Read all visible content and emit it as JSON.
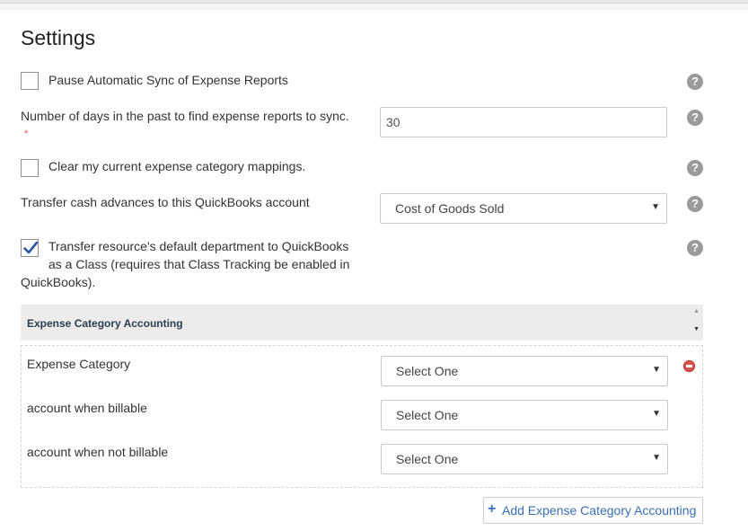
{
  "page": {
    "title": "Settings"
  },
  "settings": {
    "pause_sync": {
      "label": "Pause Automatic Sync of Expense Reports",
      "checked": false
    },
    "days_past": {
      "label": "Number of days in the past to find expense reports to sync.",
      "required_mark": "*",
      "value": "30"
    },
    "clear_mappings": {
      "label": "Clear my current expense category mappings.",
      "checked": false
    },
    "cash_advances": {
      "label": "Transfer cash advances to this QuickBooks account",
      "selected": "Cost of Goods Sold"
    },
    "transfer_department": {
      "label_line1": "Transfer resource's default department to QuickBooks",
      "label_line2": "as a Class (requires that Class Tracking be enabled in",
      "label_line3": "QuickBooks).",
      "checked": true
    },
    "help_glyph": "?"
  },
  "expense_section": {
    "title": "Expense Category Accounting",
    "rows": [
      {
        "label": "Expense Category",
        "selected": "Select One"
      },
      {
        "label": "account when billable",
        "selected": "Select One"
      },
      {
        "label": "account when not billable",
        "selected": "Select One"
      }
    ],
    "add_button": "Add Expense Category Accounting"
  },
  "glyphs": {
    "caret": "▼",
    "scroll_up": "▲",
    "scroll_down": "▼",
    "plus": "+"
  },
  "icons": {
    "help": "question-circle-icon",
    "remove": "minus-circle-icon",
    "check": "checkmark-icon",
    "add": "plus-icon"
  },
  "colors": {
    "check": "#2e56a6",
    "link": "#3a6fb5",
    "remove": "#d9534f",
    "help": "#9a9a9a",
    "required": "#d9534f"
  }
}
